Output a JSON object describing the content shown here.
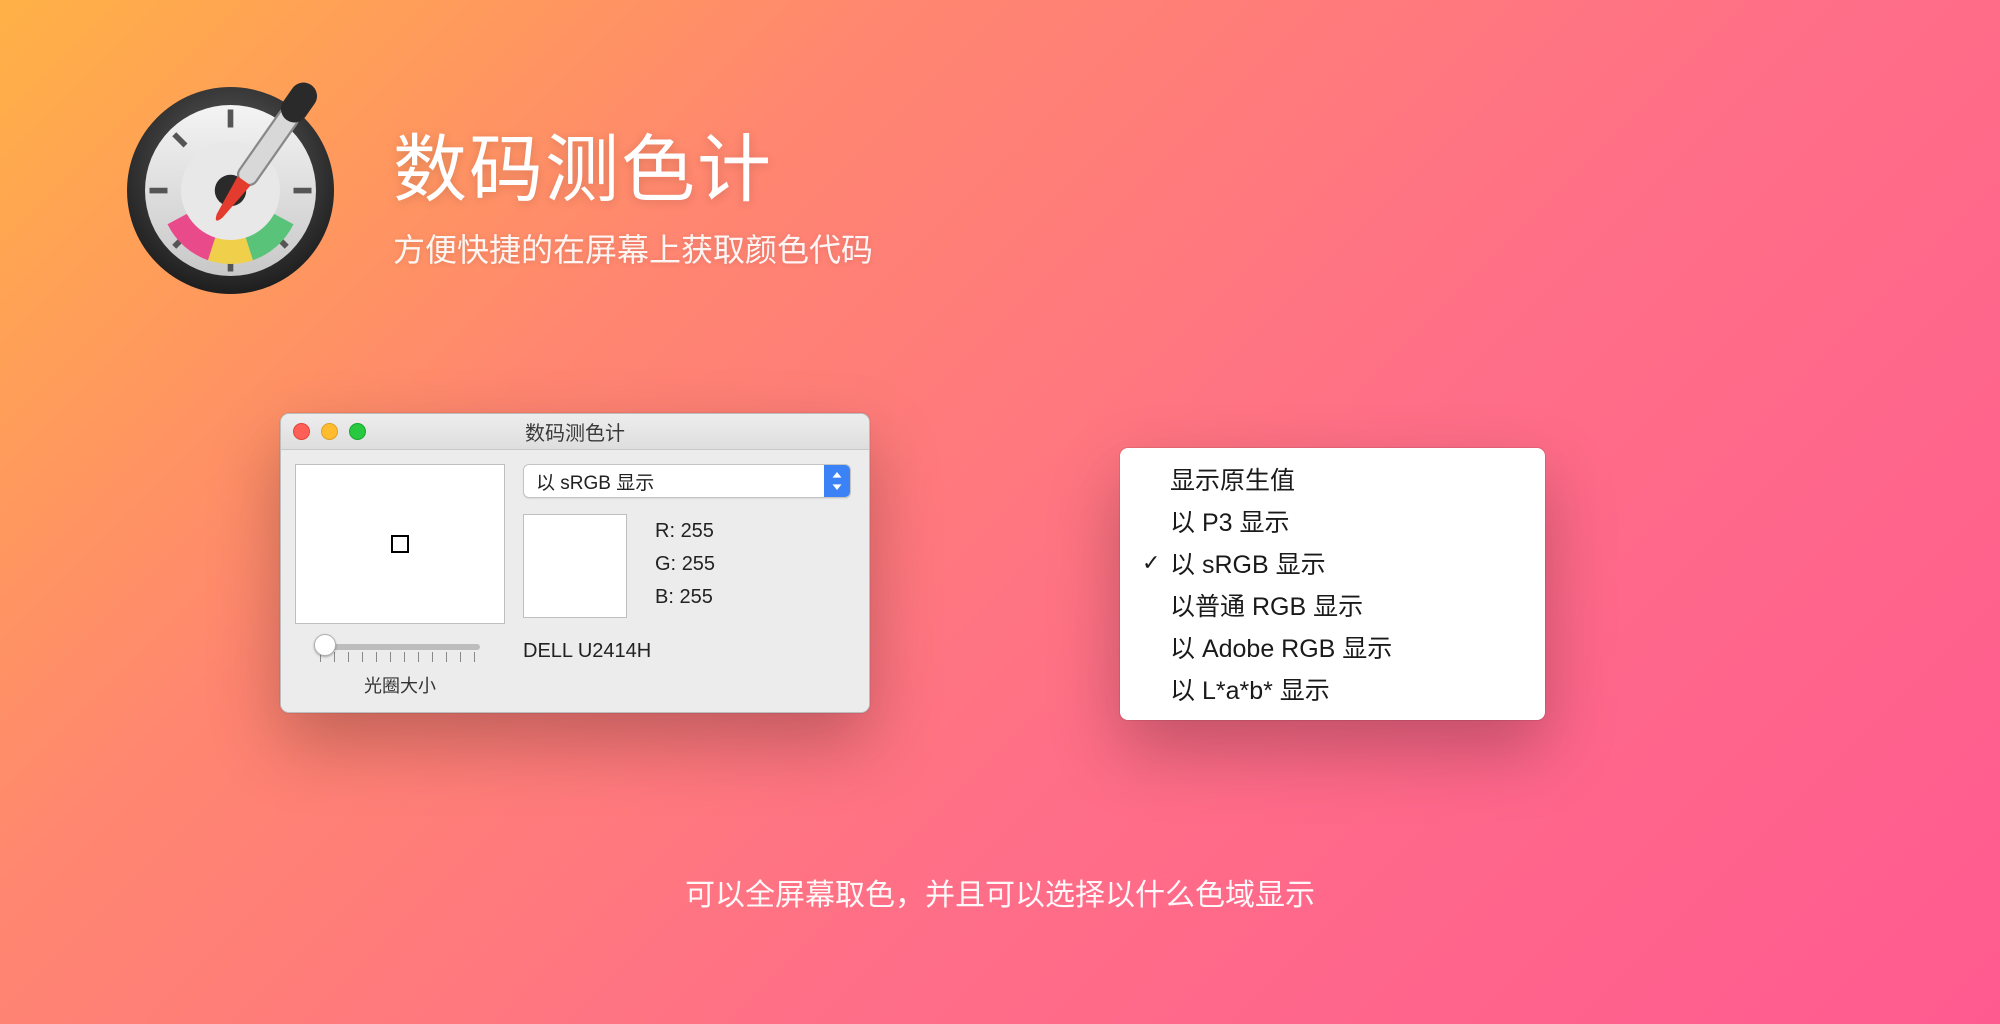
{
  "hero": {
    "title": "数码测色计",
    "subtitle": "方便快捷的在屏幕上获取颜色代码"
  },
  "window": {
    "title": "数码测色计",
    "dropdown_selected": "以 sRGB 显示",
    "slider_label": "光圈大小",
    "readout": {
      "r_label": "R:",
      "r_value": "255",
      "g_label": "G:",
      "g_value": "255",
      "b_label": "B:",
      "b_value": "255"
    },
    "display_name": "DELL U2414H"
  },
  "menu": {
    "items": [
      {
        "label": "显示原生值",
        "checked": false
      },
      {
        "label": "以 P3 显示",
        "checked": false
      },
      {
        "label": "以 sRGB 显示",
        "checked": true
      },
      {
        "label": "以普通 RGB 显示",
        "checked": false
      },
      {
        "label": "以 Adobe RGB 显示",
        "checked": false
      },
      {
        "label": "以 L*a*b* 显示",
        "checked": false
      }
    ]
  },
  "caption": "可以全屏幕取色，并且可以选择以什么色域显示"
}
